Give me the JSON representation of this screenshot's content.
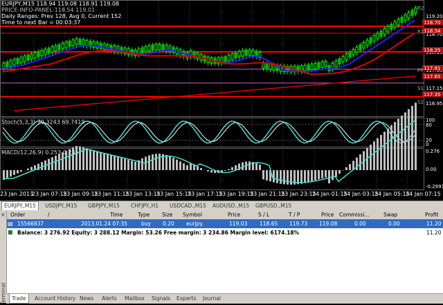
{
  "chart": {
    "info_line1": "EURJPY,M15  118.94 119.08 118.91 119.08",
    "info_line2": "PRICE-INFO-PANEL-118.54  119.01",
    "info_line3": "Daily Ranges:  Prev 128,  Avg 0,  Current 152",
    "info_line4": "Time to next Bar = 00:03:37",
    "stoch_label": "Stoch(5,3,3) 79.3243 69.7419",
    "macd_label": "MACD(12,26,9) 0.253 0.231",
    "price_labels": [
      "118.70",
      "118.54",
      "118.25",
      "117.81",
      "117.65",
      "117.35"
    ],
    "price_ticks": [
      "119.20",
      "118.70",
      "118.15",
      "117.65",
      "117.15",
      "116.95"
    ],
    "stoch_ticks": [
      "100",
      "80",
      "20",
      "0"
    ],
    "macd_ticks": [
      "0.276",
      "0.00",
      "-0.2991"
    ],
    "level_labels": [
      "R2",
      "R1",
      "PP",
      "S1",
      "S2"
    ],
    "x_ticks": [
      "23 Jan 2013",
      "23 Jan 07:15",
      "23 Jan 09:15",
      "23 Jan 11:15",
      "23 Jan 13:15",
      "23 Jan 15:15",
      "23 Jan 17:15",
      "23 Jan 19:15",
      "23 Jan 21:15",
      "23 Jan 23:15",
      "24 Jan 01:15",
      "24 Jan 03:15",
      "24 Jan 05:15",
      "24 Jan 07:15"
    ],
    "colors": {
      "up": "#00ff00",
      "down": "#00c000",
      "ma_fast": "#2222ff",
      "ma_slow": "#dd0000",
      "level_red": "#ff0000",
      "level_pink": "#cc66cc",
      "stoch_main": "#40e0d0",
      "stoch_signal": "#ffffff",
      "macd_hist": "#c0c0c0",
      "macd_signal": "#40e0d0",
      "price_tag": "#b01010"
    }
  },
  "symbol_tabs": [
    "EURJPY.,M15",
    "USDJPY.,M15",
    "GBPJPY.,M15",
    "CHFJPY.,H1",
    "USDCAD.,M15",
    "AUDUSD.,M15",
    "GBPUSD.,M15"
  ],
  "terminal": {
    "side_label": "Terminal",
    "columns": [
      "Order",
      "/",
      "Time",
      "Type",
      "Size",
      "Symbol",
      "Price",
      "S / L",
      "T / P",
      "Price",
      "Commissi...",
      "Swap",
      "Profit"
    ],
    "order": {
      "id": "15566837",
      "time": "2013.01.24 07:35",
      "type": "buy",
      "size": "0.20",
      "symbol": "eurjpy.",
      "price": "119.03",
      "sl": "118.65",
      "tp": "119.73",
      "cur_price": "119.08",
      "commission": "0.00",
      "swap": "0.00",
      "profit": "11.20"
    },
    "balance_line": "Balance: 3 276.92  Equity: 3 288.12  Margin: 53.26  Free margin: 3 234.86  Margin level: 6174.18%",
    "balance_profit": "11.20"
  },
  "bottom_tabs": [
    "Trade",
    "Account History",
    "News",
    "Alerts",
    "Mailbox",
    "Signals",
    "Experts",
    "Journal"
  ]
}
